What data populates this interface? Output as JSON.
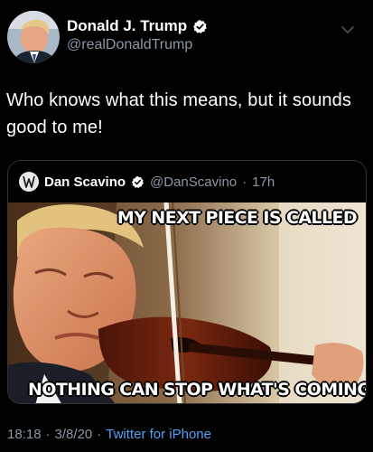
{
  "author": {
    "display_name": "Donald J. Trump",
    "handle": "@realDonaldTrump",
    "verified": true
  },
  "tweet": {
    "text": "Who knows what this means, but it sounds good to me!"
  },
  "quoted_tweet": {
    "display_name": "Dan Scavino",
    "handle": "@DanScavino",
    "separator": "·",
    "time": "17h",
    "verified": true,
    "image_caption_top": "MY NEXT PIECE IS CALLED",
    "image_caption_bottom": "NOTHING CAN STOP WHAT'S COMING"
  },
  "meta": {
    "time": "18:18",
    "sep1": "·",
    "date": "3/8/20",
    "sep2": "·",
    "source": "Twitter for iPhone"
  },
  "colors": {
    "background": "#000000",
    "secondary_text": "#8b98a5",
    "link": "#4ea3f2",
    "verified_badge": "#ffffff"
  },
  "icons": {
    "verified": "verified-badge-icon",
    "menu": "chevron-down-icon"
  }
}
